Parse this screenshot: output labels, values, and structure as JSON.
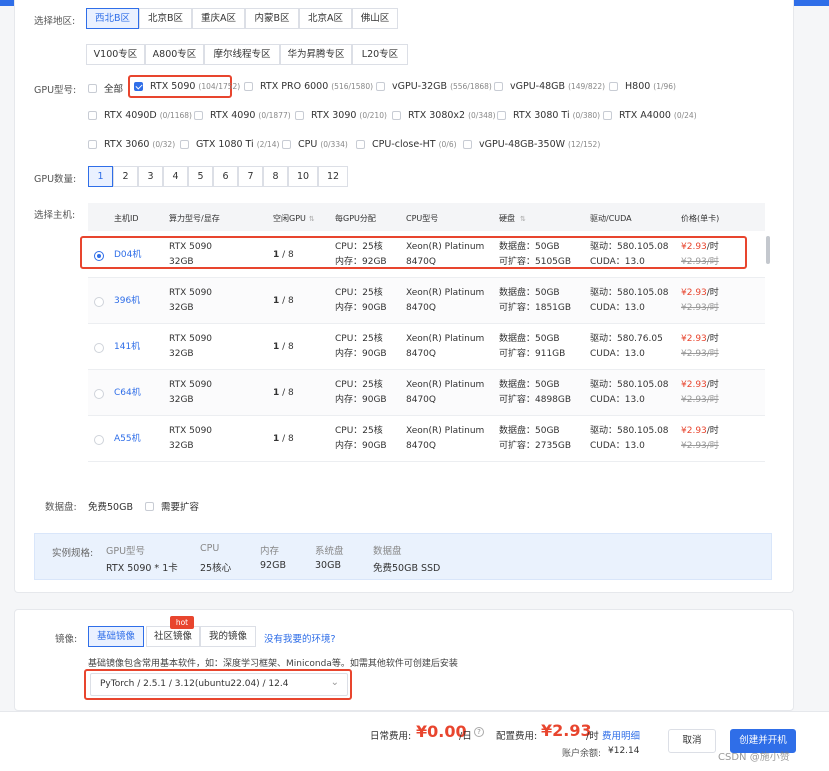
{
  "region": {
    "label": "选择地区:",
    "items": [
      "西北B区",
      "北京B区",
      "重庆A区",
      "内蒙B区",
      "北京A区",
      "佛山区"
    ],
    "items2": [
      "V100专区",
      "A800专区",
      "摩尔线程专区",
      "华为昇腾专区",
      "L20专区"
    ],
    "selected": "西北B区"
  },
  "gpu_type": {
    "label": "GPU型号:",
    "all_label": "全部",
    "options": [
      {
        "name": "RTX 5090",
        "count": "(104/1752)",
        "checked": true
      },
      {
        "name": "RTX PRO 6000",
        "count": "(516/1580)"
      },
      {
        "name": "vGPU-32GB",
        "count": "(556/1868)"
      },
      {
        "name": "vGPU-48GB",
        "count": "(149/822)"
      },
      {
        "name": "H800",
        "count": "(1/96)"
      },
      {
        "name": "RTX 4090D",
        "count": "(0/1168)"
      },
      {
        "name": "RTX 4090",
        "count": "(0/1877)"
      },
      {
        "name": "RTX 3090",
        "count": "(0/210)"
      },
      {
        "name": "RTX 3080x2",
        "count": "(0/348)"
      },
      {
        "name": "RTX 3080 Ti",
        "count": "(0/380)"
      },
      {
        "name": "RTX A4000",
        "count": "(0/24)"
      },
      {
        "name": "RTX 3060",
        "count": "(0/32)"
      },
      {
        "name": "GTX 1080 Ti",
        "count": "(2/14)"
      },
      {
        "name": "CPU",
        "count": "(0/334)"
      },
      {
        "name": "CPU-close-HT",
        "count": "(0/6)"
      },
      {
        "name": "vGPU-48GB-350W",
        "count": "(12/152)"
      }
    ]
  },
  "gpu_count": {
    "label": "GPU数量:",
    "options": [
      "1",
      "2",
      "3",
      "4",
      "5",
      "6",
      "7",
      "8",
      "10",
      "12"
    ],
    "selected": "1"
  },
  "host": {
    "label": "选择主机:",
    "columns": [
      "主机ID",
      "算力型号/显存",
      "空闲GPU",
      "每GPU分配",
      "CPU型号",
      "硬盘",
      "驱动/CUDA",
      "价格(单卡)"
    ],
    "rows": [
      {
        "id": "D04机",
        "gpu": "RTX 5090",
        "mem": "32GB",
        "free": "1",
        "total": "/ 8",
        "cpu": "CPU：25核",
        "ram": "内存：92GB",
        "cpu_model": "Xeon(R) Platinum",
        "cpu_model2": "8470Q",
        "disk": "数据盘：50GB",
        "disk_ext": "可扩容：5105GB",
        "driver": "驱动：580.105.08",
        "cuda": "CUDA：13.0",
        "price": "¥2.93",
        "unit": "/时",
        "old_price": "¥2.93/时",
        "selected": true
      },
      {
        "id": "396机",
        "gpu": "RTX 5090",
        "mem": "32GB",
        "free": "1",
        "total": "/ 8",
        "cpu": "CPU：25核",
        "ram": "内存：90GB",
        "cpu_model": "Xeon(R) Platinum",
        "cpu_model2": "8470Q",
        "disk": "数据盘：50GB",
        "disk_ext": "可扩容：1851GB",
        "driver": "驱动：580.105.08",
        "cuda": "CUDA：13.0",
        "price": "¥2.93",
        "unit": "/时",
        "old_price": "¥2.93/时"
      },
      {
        "id": "141机",
        "gpu": "RTX 5090",
        "mem": "32GB",
        "free": "1",
        "total": "/ 8",
        "cpu": "CPU：25核",
        "ram": "内存：90GB",
        "cpu_model": "Xeon(R) Platinum",
        "cpu_model2": "8470Q",
        "disk": "数据盘：50GB",
        "disk_ext": "可扩容：911GB",
        "driver": "驱动：580.76.05",
        "cuda": "CUDA：13.0",
        "price": "¥2.93",
        "unit": "/时",
        "old_price": "¥2.93/时"
      },
      {
        "id": "C64机",
        "gpu": "RTX 5090",
        "mem": "32GB",
        "free": "1",
        "total": "/ 8",
        "cpu": "CPU：25核",
        "ram": "内存：90GB",
        "cpu_model": "Xeon(R) Platinum",
        "cpu_model2": "8470Q",
        "disk": "数据盘：50GB",
        "disk_ext": "可扩容：4898GB",
        "driver": "驱动：580.105.08",
        "cuda": "CUDA：13.0",
        "price": "¥2.93",
        "unit": "/时",
        "old_price": "¥2.93/时"
      },
      {
        "id": "A55机",
        "gpu": "RTX 5090",
        "mem": "32GB",
        "free": "1",
        "total": "/ 8",
        "cpu": "CPU：25核",
        "ram": "内存：90GB",
        "cpu_model": "Xeon(R) Platinum",
        "cpu_model2": "8470Q",
        "disk": "数据盘：50GB",
        "disk_ext": "可扩容：2735GB",
        "driver": "驱动：580.105.08",
        "cuda": "CUDA：13.0",
        "price": "¥2.93",
        "unit": "/时",
        "old_price": "¥2.93/时"
      }
    ]
  },
  "data_disk": {
    "label": "数据盘:",
    "value": "免费50GB",
    "expand_label": "需要扩容"
  },
  "spec": {
    "label": "实例规格:",
    "cols": [
      {
        "head": "GPU型号",
        "value": "RTX 5090 * 1卡"
      },
      {
        "head": "CPU",
        "value": "25核心"
      },
      {
        "head": "内存",
        "value": "92GB"
      },
      {
        "head": "系统盘",
        "value": "30GB"
      },
      {
        "head": "数据盘",
        "value": "免费50GB SSD"
      }
    ]
  },
  "image": {
    "label": "镜像:",
    "tabs": [
      "基础镜像",
      "社区镜像",
      "我的镜像"
    ],
    "hot_badge": "hot",
    "link": "没有我要的环境?",
    "desc": "基础镜像包含常用基本软件，如：深度学习框架、Miniconda等。如需其他软件可创建后安装",
    "selected_value": "PyTorch / 2.5.1 / 3.12(ubuntu22.04) / 12.4"
  },
  "footer": {
    "daily_label": "日常费用:",
    "daily_value": "¥0.00",
    "daily_unit": "/日",
    "config_label": "配置费用:",
    "config_value": "¥2.93",
    "config_unit": "/时",
    "detail_link": "费用明细",
    "balance_label": "账户余额:",
    "balance_value": "¥12.14",
    "cancel": "取消",
    "create": "创建并开机",
    "watermark": "CSDN @施小赞"
  },
  "colors": {
    "accent": "#2f6ee8",
    "highlight": "#e8452e"
  }
}
